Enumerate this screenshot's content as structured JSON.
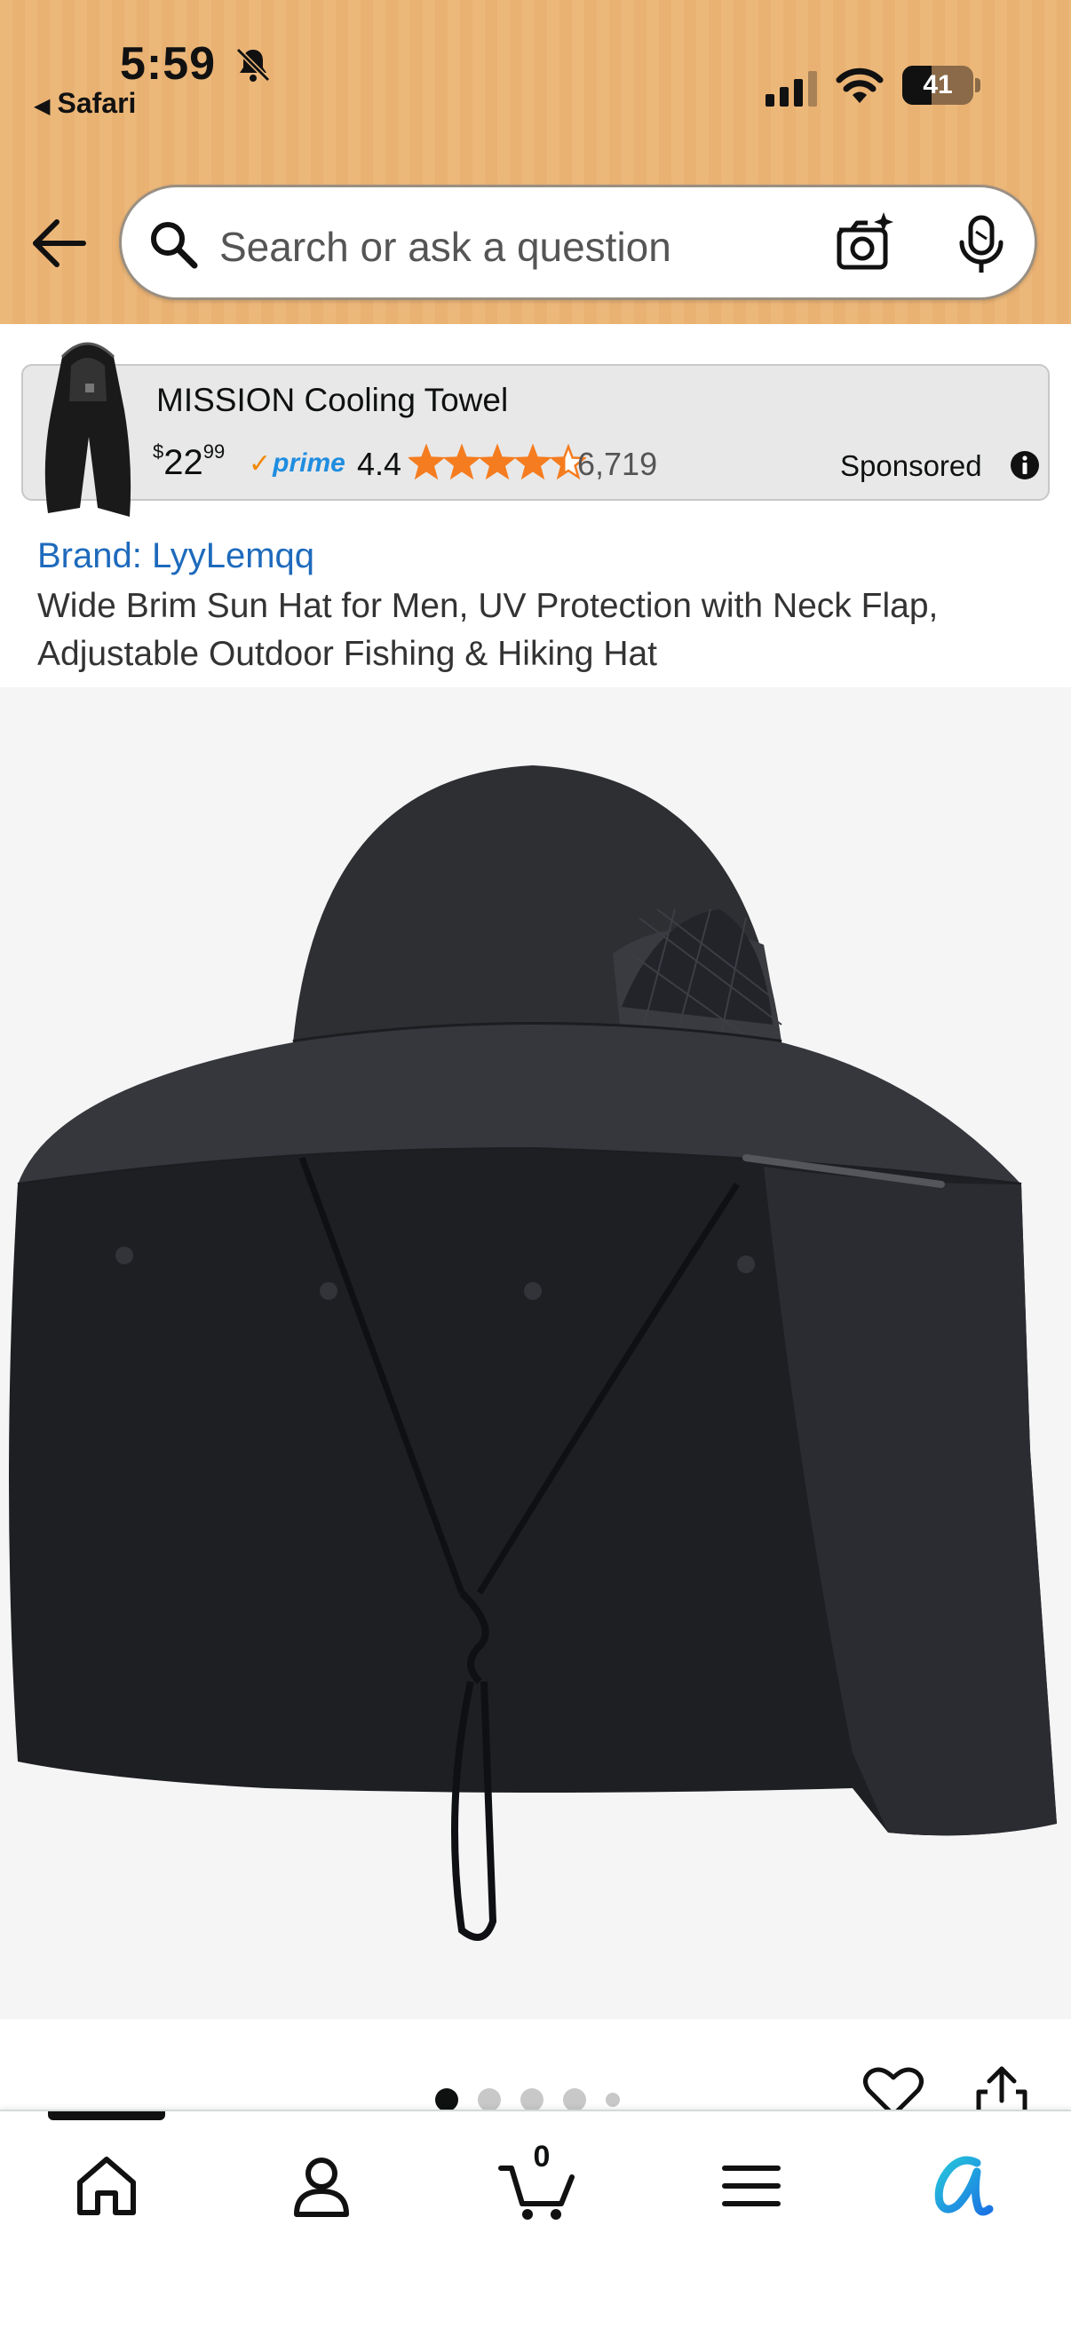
{
  "status_bar": {
    "time": "5:59",
    "back_app": "Safari",
    "battery": "41",
    "battery_level": 0.41
  },
  "search": {
    "placeholder": "Search or ask a question"
  },
  "ad": {
    "title": "MISSION Cooling Towel",
    "price_symbol": "$",
    "price_whole": "22",
    "price_fraction": "99",
    "prime_label": "prime",
    "rating": "4.4",
    "rating_value": 4.4,
    "reviews": "6,719",
    "sponsored_label": "Sponsored"
  },
  "product": {
    "brand": "Brand: LyyLemqq",
    "title": "Wide Brim Sun Hat for Men, UV Protection with Neck Flap, Adjustable Outdoor Fishing & Hiking Hat",
    "image_count": 5,
    "active_image": 1
  },
  "bottom_nav": {
    "cart_count": "0",
    "items": [
      "home-icon",
      "account-icon",
      "cart-icon",
      "menu-icon",
      "rufus-icon"
    ]
  },
  "colors": {
    "header_bg": "#ecb87a",
    "link_blue": "#1e6abc",
    "prime_blue": "#1f8de0",
    "star_orange": "#f57c1f",
    "rufus_blue": "#1b74e4"
  }
}
